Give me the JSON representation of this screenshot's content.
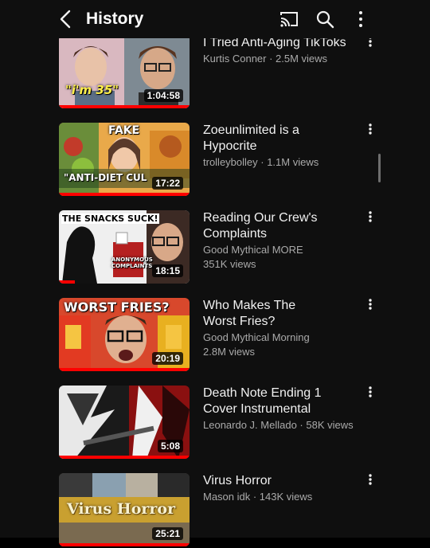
{
  "header": {
    "title": "History",
    "icons": [
      "back-arrow-icon",
      "cast-icon",
      "search-icon",
      "more-vert-icon"
    ]
  },
  "videos": [
    {
      "title": "I Tried Anti-Aging TikToks",
      "meta": "Kurtis Conner · 2.5M views",
      "duration": "1:04:58",
      "thumb_text": "\"i'm 35\"",
      "progress_fraction": 1.0
    },
    {
      "title": "Zoeunlimited is a Hypocrite",
      "meta": "trolleybolley · 1.1M views",
      "duration": "17:22",
      "thumb_text": "FAKE",
      "thumb_text2": "\"ANTI-DIET CUL",
      "progress_fraction": 1.0
    },
    {
      "title": "Reading Our Crew's Complaints",
      "meta": "Good Mythical MORE",
      "meta2": "351K views",
      "duration": "18:15",
      "thumb_text": "THE SNACKS SUCK!",
      "thumb_text2": "ANONYMOUS COMPLAINTS",
      "progress_fraction": 0.12
    },
    {
      "title": "Who Makes The Worst Fries?",
      "meta": "Good Mythical Morning",
      "meta2": "2.8M views",
      "duration": "20:19",
      "thumb_text": "WORST FRIES?",
      "progress_fraction": 1.0
    },
    {
      "title": "Death Note Ending 1 Cover Instrumental",
      "meta": "Leonardo J. Mellado · 58K views",
      "duration": "5:08",
      "progress_fraction": 1.0
    },
    {
      "title": "Virus Horror",
      "meta": "Mason idk · 143K views",
      "duration": "25:21",
      "thumb_text": "Virus Horror",
      "progress_fraction": 1.0
    }
  ],
  "colors": {
    "background": "#0f0f0f",
    "progress": "#ff0000",
    "secondary_text": "#aaaaaa"
  }
}
